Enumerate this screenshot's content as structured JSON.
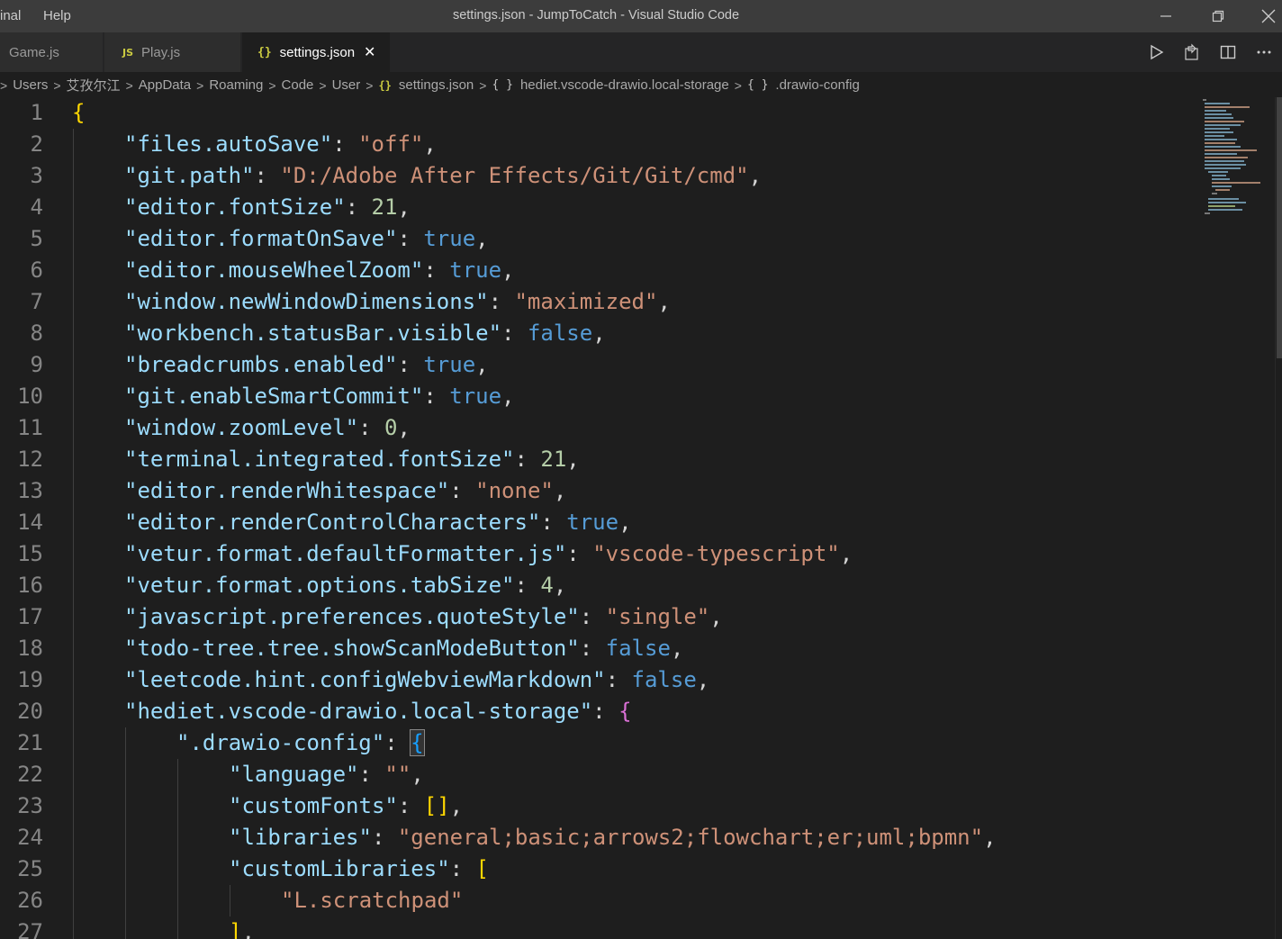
{
  "menu": {
    "terminal_partial": "inal",
    "help": "Help"
  },
  "window": {
    "title": "settings.json - JumpToCatch - Visual Studio Code"
  },
  "window_controls": {
    "minimize_icon": "minimize-icon",
    "restore_icon": "restore-icon",
    "close_icon": "close-icon"
  },
  "tabs": [
    {
      "label": "Game.js",
      "icon": "js-file-icon",
      "active": false
    },
    {
      "label": "Play.js",
      "icon": "js-file-icon",
      "badge": "JS",
      "active": false
    },
    {
      "label": "settings.json",
      "icon": "json-file-icon",
      "badge": "{}",
      "active": true,
      "close": "✕"
    }
  ],
  "editor_actions": [
    "run-icon",
    "open-settings-ui-icon",
    "split-editor-icon",
    "more-actions-icon"
  ],
  "breadcrumb": {
    "items": [
      "Users",
      "艾孜尔江",
      "AppData",
      "Roaming",
      "Code",
      "User",
      "settings.json",
      "hediet.vscode-drawio.local-storage",
      ".drawio-config"
    ],
    "json_icon": "{}",
    "object_icon": "{ }"
  },
  "editor": {
    "lines": [
      "{",
      "\"files.autoSave\": \"off\",",
      "\"git.path\": \"D:/Adobe After Effects/Git/Git/cmd\",",
      "\"editor.fontSize\": 21,",
      "\"editor.formatOnSave\": true,",
      "\"editor.mouseWheelZoom\": true,",
      "\"window.newWindowDimensions\": \"maximized\",",
      "\"workbench.statusBar.visible\": false,",
      "\"breadcrumbs.enabled\": true,",
      "\"git.enableSmartCommit\": true,",
      "\"window.zoomLevel\": 0,",
      "\"terminal.integrated.fontSize\": 21,",
      "\"editor.renderWhitespace\": \"none\",",
      "\"editor.renderControlCharacters\": true,",
      "\"vetur.format.defaultFormatter.js\": \"vscode-typescript\",",
      "\"vetur.format.options.tabSize\": 4,",
      "\"javascript.preferences.quoteStyle\": \"single\",",
      "\"todo-tree.tree.showScanModeButton\": false,",
      "\"leetcode.hint.configWebviewMarkdown\": false,",
      "\"hediet.vscode-drawio.local-storage\": {",
      "\".drawio-config\": {",
      "\"language\": \"\",",
      "\"customFonts\": [],",
      "\"libraries\": \"general;basic;arrows2;flowchart;er;uml;bpmn\",",
      "\"customLibraries\": [",
      "\"L.scratchpad\"",
      "],"
    ],
    "line_numbers": [
      "1",
      "2",
      "3",
      "4",
      "5",
      "6",
      "7",
      "8",
      "9",
      "10",
      "11",
      "12",
      "13",
      "14",
      "15",
      "16",
      "17",
      "18",
      "19",
      "20",
      "21",
      "22",
      "23",
      "24",
      "25",
      "26",
      "27"
    ]
  },
  "colors": {
    "background": "#1e1e1e",
    "titlebar": "#3c3c3c",
    "key": "#9cdcfe",
    "string": "#ce9178",
    "number": "#b5cea8",
    "boolean": "#569cd6",
    "bracket_level1": "#ffd700",
    "bracket_level2": "#da70d6",
    "bracket_level3": "#179fff",
    "json_icon": "#cbcb41"
  }
}
